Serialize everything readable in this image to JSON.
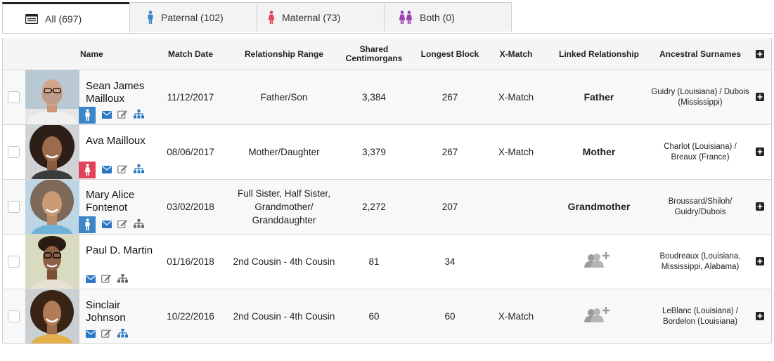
{
  "tabs": [
    {
      "label": "All (697)",
      "icon": "list-icon",
      "color": "#222222"
    },
    {
      "label": "Paternal (102)",
      "icon": "male-icon",
      "color": "#3a86c8"
    },
    {
      "label": "Maternal (73)",
      "icon": "female-icon",
      "color": "#e0445a"
    },
    {
      "label": "Both (0)",
      "icon": "couple-icon",
      "color": "#9b3fb5"
    }
  ],
  "columns": {
    "name": "Name",
    "match_date": "Match Date",
    "relationship_range": "Relationship Range",
    "shared_cm": "Shared Centimorgans",
    "longest_block": "Longest Block",
    "xmatch": "X-Match",
    "linked_relationship": "Linked Relationship",
    "ancestral_surnames": "Ancestral Surnames"
  },
  "colors": {
    "paternal": "#3a86c8",
    "maternal": "#e0445a",
    "action_blue": "#2a78c2",
    "action_gray": "#777777"
  },
  "rows": [
    {
      "name": "Sean James Mailloux",
      "side": "paternal",
      "match_date": "11/12/2017",
      "relationship_range": "Father/Son",
      "shared_cm": "3,384",
      "longest_block": "267",
      "xmatch": "X-Match",
      "linked_relationship": "Father",
      "ancestral_surnames": "Guidry (Louisiana) / Dubois (Mississippi)"
    },
    {
      "name": "Ava Mailloux",
      "side": "maternal",
      "match_date": "08/06/2017",
      "relationship_range": "Mother/Daughter",
      "shared_cm": "3,379",
      "longest_block": "267",
      "xmatch": "X-Match",
      "linked_relationship": "Mother",
      "ancestral_surnames": "Charlot (Louisiana) / Breaux (France)"
    },
    {
      "name": "Mary Alice Fontenot",
      "side": "paternal",
      "match_date": "03/02/2018",
      "relationship_range": "Full Sister, Half Sister, Grandmother/ Granddaughter",
      "shared_cm": "2,272",
      "longest_block": "207",
      "xmatch": "",
      "linked_relationship": "Grandmother",
      "ancestral_surnames": "Broussard/Shiloh/ Guidry/Dubois"
    },
    {
      "name": "Paul D. Martin",
      "side": "",
      "match_date": "01/16/2018",
      "relationship_range": "2nd Cousin - 4th Cousin",
      "shared_cm": "81",
      "longest_block": "34",
      "xmatch": "",
      "linked_relationship": "",
      "ancestral_surnames": "Boudreaux (Louisiana, Mississippi, Alabama)"
    },
    {
      "name": "Sinclair Johnson",
      "side": "",
      "match_date": "10/22/2016",
      "relationship_range": "2nd Cousin - 4th Cousin",
      "shared_cm": "60",
      "longest_block": "60",
      "xmatch": "X-Match",
      "linked_relationship": "",
      "ancestral_surnames": "LeBlanc (Louisiana) / Bordelon (Louisiana)"
    }
  ]
}
